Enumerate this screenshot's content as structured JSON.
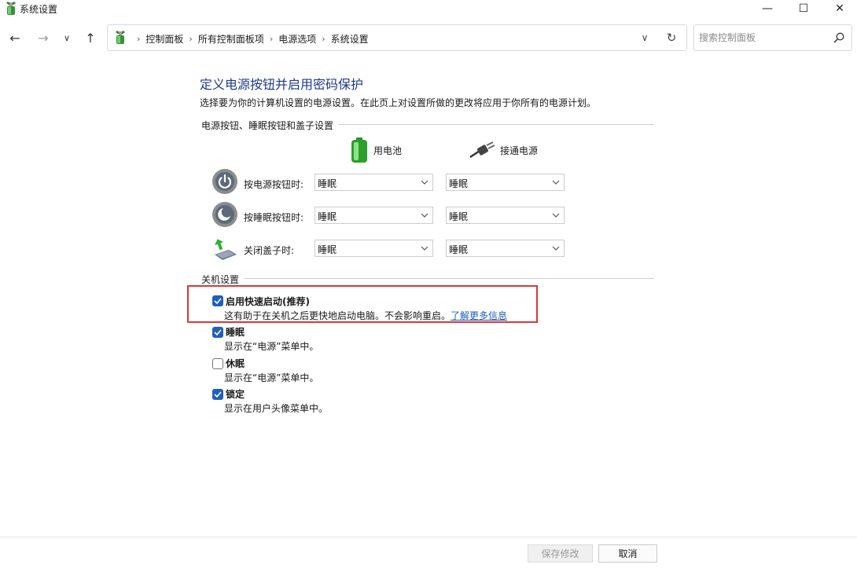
{
  "window": {
    "title": "系统设置",
    "minimize_glyph": "—",
    "maximize_glyph": "☐",
    "close_glyph": "✕"
  },
  "nav": {
    "back_glyph": "←",
    "forward_glyph": "→",
    "recent_glyph": "∨",
    "up_glyph": "↑",
    "breadcrumbs": [
      "控制面板",
      "所有控制面板项",
      "电源选项",
      "系统设置"
    ],
    "separator": "›",
    "dropdown_glyph": "∨",
    "refresh_glyph": "↻"
  },
  "search": {
    "placeholder": "搜索控制面板"
  },
  "main": {
    "title": "定义电源按钮并启用密码保护",
    "description": "选择要为你的计算机设置的电源设置。在此页上对设置所做的更改将应用于你所有的电源计划。",
    "power_section": {
      "label": "电源按钮、睡眠按钮和盖子设置",
      "battery_label": "用电池",
      "plugged_label": "接通电源",
      "rows": [
        {
          "label": "按电源按钮时:",
          "battery": "睡眠",
          "plugged": "睡眠"
        },
        {
          "label": "按睡眠按钮时:",
          "battery": "睡眠",
          "plugged": "睡眠"
        },
        {
          "label": "关闭盖子时:",
          "battery": "睡眠",
          "plugged": "睡眠"
        }
      ]
    },
    "shutdown_section": {
      "label": "关机设置",
      "options": [
        {
          "title": "启用快速启动(推荐)",
          "desc": "这有助于在关机之后更快地启动电脑。不会影响重启。",
          "link": "了解更多信息",
          "checked": true
        },
        {
          "title": "睡眠",
          "desc": "显示在“电源”菜单中。",
          "checked": true
        },
        {
          "title": "休眠",
          "desc": "显示在“电源”菜单中。",
          "checked": false
        },
        {
          "title": "锁定",
          "desc": "显示在用户头像菜单中。",
          "checked": true
        }
      ]
    }
  },
  "footer": {
    "save_label": "保存修改",
    "cancel_label": "取消"
  },
  "colors": {
    "title_blue": "#1e3a8a",
    "checkbox_blue": "#1f5fbf",
    "highlight_red": "#d93838",
    "link_blue": "#1a5fbf"
  }
}
